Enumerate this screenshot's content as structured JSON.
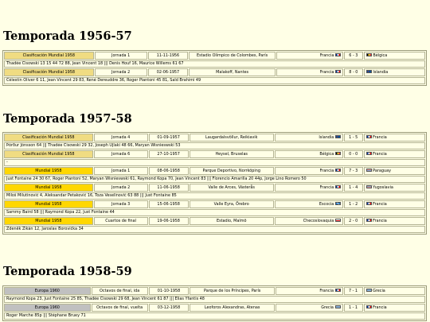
{
  "seasons": [
    {
      "title": "Temporada 1956-57",
      "matches": [
        {
          "competition": "Clasificación Mundial 1958",
          "round": "Jornada 1",
          "date": "11-11-1956",
          "venue": "Estadio Olímpico de Colombes, París",
          "home": "Francia",
          "home_flag": "france-flag",
          "score": "6 - 3",
          "away": "Bélgica",
          "away_flag": "belgium-flag",
          "scorers": "Thadée Cisowski 13 15 44 72 88, Jean Vincent 18 ||| Denis Houf 16, Maurice Willems 61 67"
        },
        {
          "competition": "Clasificación Mundial 1958",
          "round": "Jornada 2",
          "date": "02-06-1957",
          "venue": "Malakoff, Nantes",
          "home": "Francia",
          "home_flag": "france-flag",
          "score": "8 - 0",
          "away": "Islandia",
          "away_flag": "iceland-flag",
          "scorers": "Célestin Oliver 6 11, Jean Vincent 29 83, René Dereuddre 36, Roger Piantoni 45 81, Saïd Brahimi 49"
        }
      ]
    },
    {
      "title": "Temporada 1957-58",
      "matches": [
        {
          "competition": "Clasificación Mundial 1958",
          "round": "Jornada 4",
          "date": "01-09-1957",
          "venue": "Laugardalsvöllur, Reikiavik",
          "home": "Islandia",
          "home_flag": "iceland-flag",
          "score": "1 - 5",
          "away": "Francia",
          "away_flag": "france-flag",
          "scorers": "Þórður Jónsson 64 ||| Thadée Cisowski 29 32, Joseph Ujlaki 48 66, Maryan Wisnieswski 53"
        },
        {
          "competition": "Clasificación Mundial 1958",
          "round": "Jornada 6",
          "date": "27-10-1957",
          "venue": "Heysel, Bruselas",
          "home": "Bélgica",
          "home_flag": "belgium-flag",
          "score": "0 - 0",
          "away": "Francia",
          "away_flag": "france-flag",
          "scorers": "-"
        },
        {
          "competition": "Mundial 1958",
          "round": "Jornada 1",
          "date": "08-06-1958",
          "venue": "Parque Deportivo, Norrköping",
          "home": "Francia",
          "home_flag": "france-flag",
          "score": "7 - 3",
          "away": "Paraguay",
          "away_flag": "paraguay-flag",
          "scorers": "Just Fontaine 24 30 67, Roger Piantoni 52, Maryan Wisnieswski 61, Raymond Kopa 70, Jean Vincent 83 ||| Florencio Amarilla 20 44p, Jorge Lino Romero 50"
        },
        {
          "competition": "Mundial 1958",
          "round": "Jornada 2",
          "date": "11-06-1958",
          "venue": "Valle de Arces, Västerås",
          "home": "Francia",
          "home_flag": "france-flag",
          "score": "1 - 4",
          "away": "Yugoslavia",
          "away_flag": "yugoslavia-flag",
          "scorers": "Miloš Milutinović 4, Aleksandar Petaković 16, Toza Veselinović 63 88 ||| Just Fontaine 85"
        },
        {
          "competition": "Mundial 1958",
          "round": "Jornada 3",
          "date": "15-06-1958",
          "venue": "Valle Eyra, Örebro",
          "home": "Escocia",
          "home_flag": "scotland-flag",
          "score": "1 - 2",
          "away": "Francia",
          "away_flag": "france-flag",
          "scorers": "Sammy Baird 58 ||| Raymond Kopa 22, Just Fontaine 44"
        },
        {
          "competition": "Mundial 1958",
          "round": "Cuartos de final",
          "date": "19-06-1958",
          "venue": "Estadio, Malmö",
          "home": "Checoslovaquia",
          "home_flag": "czechoslovakia-flag",
          "score": "2 - 0",
          "away": "Francia",
          "away_flag": "france-flag",
          "scorers": "Zdeněk Zikán 12, Jaroslav Borovička 34"
        }
      ]
    },
    {
      "title": "Temporada 1958-59",
      "matches": [
        {
          "competition": "Europa 1960",
          "round": "Octavos de final, ida",
          "date": "01-10-1958",
          "venue": "Parque de los Príncipes, París",
          "home": "Francia",
          "home_flag": "france-flag",
          "score": "7 - 1",
          "away": "Grecia",
          "away_flag": "greece-flag",
          "scorers": "Raymond Kopa 23, Just Fontaine 25 85, Thadée Cisowski 29 68, Jean Vincent 61 87 ||| Elias Yfantis 48"
        },
        {
          "competition": "Europa 1960",
          "round": "Octavos de final, vuelta",
          "date": "03-12-1958",
          "venue": "Leoforos Alexandras, Atenas",
          "home": "Grecia",
          "home_flag": "greece-flag",
          "score": "1 - 1",
          "away": "Francia",
          "away_flag": "france-flag",
          "scorers": "Roger Marche 85p ||| Stéphane Bruey 71"
        }
      ]
    }
  ],
  "colors": {
    "background": "#ffffe6",
    "qualifier": "#f0dc82",
    "world_cup": "#ffd700",
    "euro": "#c0c0c0"
  }
}
